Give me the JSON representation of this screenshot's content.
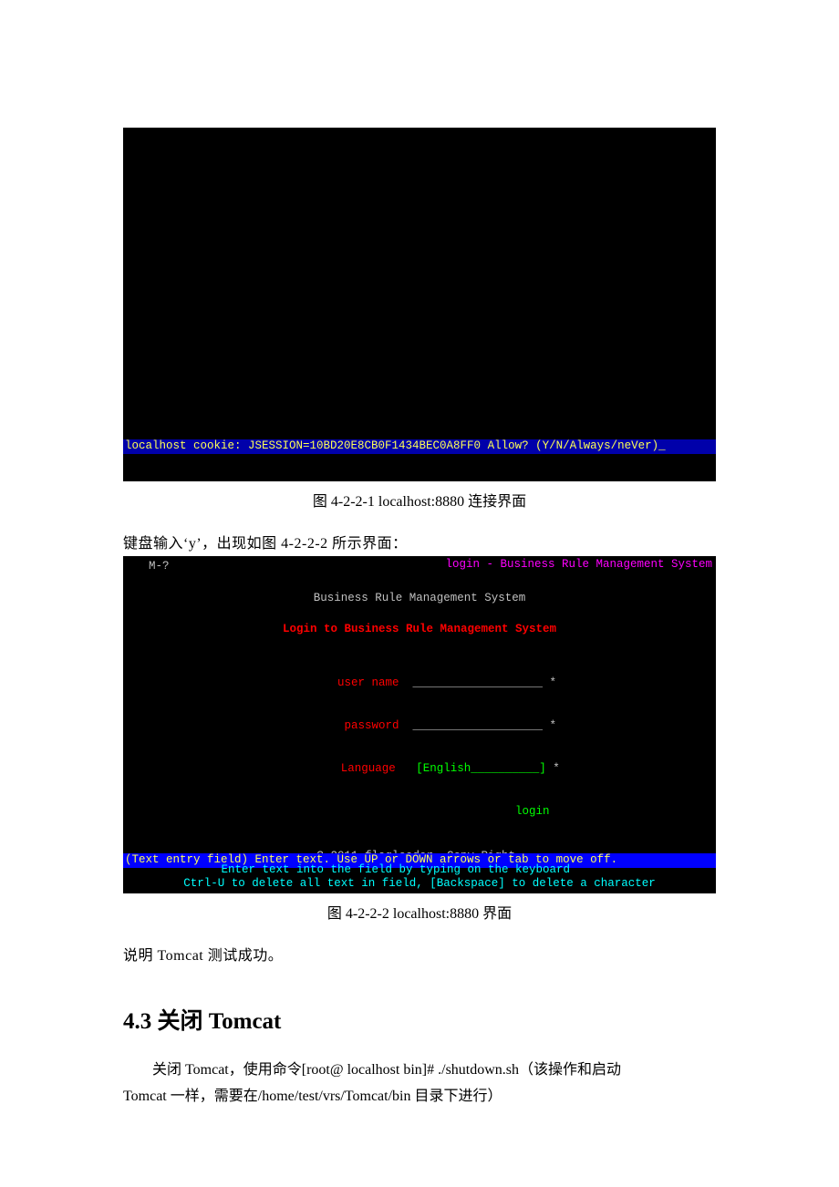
{
  "terminal1": {
    "cookie_prompt": "localhost cookie: JSESSION=10BD20E8CB0F1434BEC0A8FF0 Allow? (Y/N/Always/neVer)_"
  },
  "caption1": "图 4-2-2-1   localhost:8880 连接界面",
  "body_intro": "键盘输入‘y’，出现如图 4-2-2-2 所示界面：",
  "terminal2": {
    "topright": "login - Business Rule Management System",
    "menu": "M-?",
    "title": "Business Rule Management System",
    "subtitle": "Login to Business Rule Management System",
    "label_user": "user name",
    "field_user": "___________________",
    "star": "*",
    "label_pass": "password",
    "field_pass": "___________________",
    "label_lang": "Language",
    "field_lang": "[English__________]",
    "login": "login",
    "copyright": "? 2011 flagleader. Copy Right.",
    "instr1": "(Text entry field) Enter text.  Use UP or DOWN arrows or tab to move off.",
    "instr2": "    Enter text into the field by typing on the keyboard           ",
    "instr3": "Ctrl-U to delete all text in field, [Backspace] to delete a character"
  },
  "caption2": "图 4-2-2-2   localhost:8880 界面",
  "success_text": "说明 Tomcat 测试成功。",
  "section_heading": "4.3 关闭 Tomcat",
  "paragraph_a": "关闭 Tomcat，使用命令[root@ localhost bin]# ./shutdown.sh（该操作和启动",
  "paragraph_b": "Tomcat 一样，需要在/home/test/vrs/Tomcat/bin  目录下进行）"
}
